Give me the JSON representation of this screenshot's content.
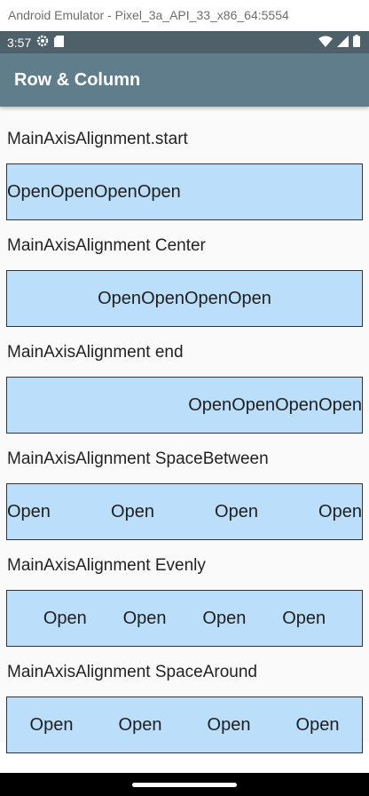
{
  "window": {
    "title": "Android Emulator - Pixel_3a_API_33_x86_64:5554"
  },
  "status_bar": {
    "time": "3:57",
    "icons": [
      "settings-icon",
      "sd-card-icon",
      "wifi-icon",
      "signal-icon",
      "battery-icon"
    ]
  },
  "app_bar": {
    "title": "Row & Column",
    "color": "#607d8b"
  },
  "colors": {
    "row_background": "#bbdefb",
    "status_bar": "#4e616b"
  },
  "sections": [
    {
      "label": "MainAxisAlignment.start",
      "items": [
        "Open",
        "Open",
        "Open",
        "Open"
      ]
    },
    {
      "label": "MainAxisAlignment Center",
      "items": [
        "Open",
        "Open",
        "Open",
        "Open"
      ]
    },
    {
      "label": "MainAxisAlignment end",
      "items": [
        "Open",
        "Open",
        "Open",
        "Open"
      ]
    },
    {
      "label": "MainAxisAlignment SpaceBetween",
      "items": [
        "Open",
        "Open",
        "Open",
        "Open"
      ]
    },
    {
      "label": "MainAxisAlignment Evenly",
      "items": [
        "Open",
        "Open",
        "Open",
        "Open"
      ]
    },
    {
      "label": "MainAxisAlignment SpaceAround",
      "items": [
        "Open",
        "Open",
        "Open",
        "Open"
      ]
    }
  ]
}
